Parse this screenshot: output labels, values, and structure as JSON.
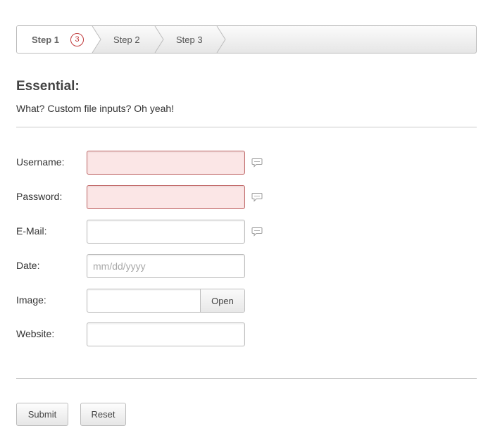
{
  "wizard": {
    "steps": [
      {
        "label": "Step 1",
        "badge": "3",
        "active": true
      },
      {
        "label": "Step 2",
        "active": false
      },
      {
        "label": "Step 3",
        "active": false
      }
    ]
  },
  "section": {
    "title": "Essential:",
    "subtitle": "What? Custom file inputs? Oh yeah!"
  },
  "form": {
    "username": {
      "label": "Username:",
      "value": "",
      "state": "error"
    },
    "password": {
      "label": "Password:",
      "value": "",
      "state": "error"
    },
    "email": {
      "label": "E-Mail:",
      "value": ""
    },
    "date": {
      "label": "Date:",
      "value": "",
      "placeholder": "mm/dd/yyyy"
    },
    "image": {
      "label": "Image:",
      "value": "",
      "button": "Open"
    },
    "website": {
      "label": "Website:",
      "value": ""
    }
  },
  "actions": {
    "submit": "Submit",
    "reset": "Reset"
  },
  "colors": {
    "error_bg": "#fbe6e6",
    "error_border": "#c26a6a",
    "badge": "#c0393b"
  },
  "icons": {
    "hint": "speech-bubble-icon"
  }
}
